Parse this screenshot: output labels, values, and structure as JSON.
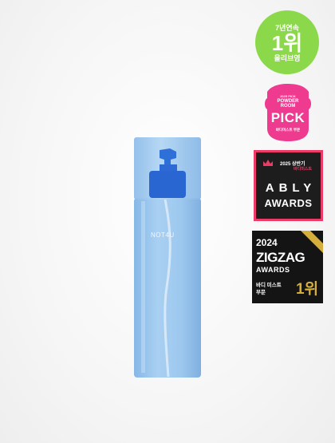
{
  "product": {
    "brand_text": "NOT4U",
    "bottle_color": "#9cc6ec",
    "pump_color": "#2f6fd8"
  },
  "badges": {
    "rank": {
      "top_text": "7년연속",
      "big_text": "1위",
      "bottom_text": "올리브영",
      "color": "#8bd84a"
    },
    "powder_room": {
      "year_text": "2025 PICK",
      "line1": "POWDER",
      "line2": "ROOM",
      "big_text": "PICK",
      "category": "바디미스트 부문",
      "color": "#ee3a8f"
    },
    "ably": {
      "year_text": "2025 상반기",
      "category": "바디미스트",
      "brand": "ABLY",
      "awards": "AWARDS",
      "accent": "#ee3a67"
    },
    "zigzag": {
      "year": "2024",
      "brand": "ZIGZAG",
      "awards": "AWARDS",
      "category_line1": "바디 미스트",
      "category_line2": "부문",
      "rank": "1위",
      "accent": "#d6ae3a"
    }
  }
}
